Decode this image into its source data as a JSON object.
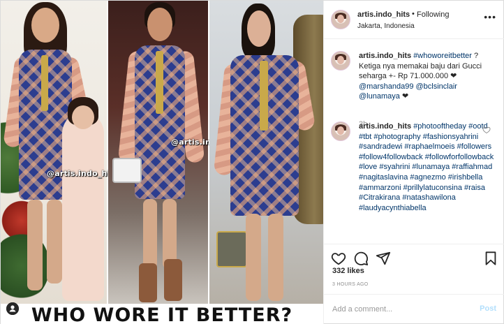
{
  "header": {
    "username": "artis.indo_hits",
    "separator": "•",
    "follow_status": "Following",
    "location": "Jakarta, Indonesia",
    "more_icon": "ellipsis-icon"
  },
  "media": {
    "watermark_left": "@artis.indo_hits",
    "watermark_middle": "@artis.indo_hits",
    "banner": "WHO WORE IT BETTER?",
    "corner_icon": "user-tag-icon"
  },
  "caption": {
    "username": "artis.indo_hits",
    "hashtag": "#whoworeitbetter",
    "text_after_hashtag": " ? Ketiga nya memakai baju dari Gucci seharga +- Rp 71.000.000 ❤",
    "mentions": [
      "@marshanda99",
      "@bclsinclair",
      "@lunamaya"
    ],
    "trailing_emoji": "❤",
    "time": "3h"
  },
  "comment": {
    "username": "artis.indo_hits",
    "hashtags": "#photooftheday #ootd #tbt #photography #fashionsyahrini #sandradewi #raphaelmoeis #followers #follow4followback #followforfollowback #love #syahrini #lunamaya #raffiahmad #nagitaslavina #agnezmo #irishbella #ammarzoni #prillylatuconsina #raisa #Citrakirana #natashawilona #laudyacynthiabella",
    "like_icon": "heart-outline-icon"
  },
  "actions": {
    "like_icon": "heart-icon",
    "comment_icon": "comment-bubble-icon",
    "share_icon": "paper-plane-icon",
    "save_icon": "bookmark-icon",
    "likes": "332 likes",
    "posted": "3 HOURS AGO"
  },
  "add_comment": {
    "placeholder": "Add a comment...",
    "post_label": "Post"
  },
  "colors": {
    "link": "#003569",
    "muted": "#8e8e8e",
    "post_button": "#b2dffc",
    "border": "#dbdbdb"
  }
}
